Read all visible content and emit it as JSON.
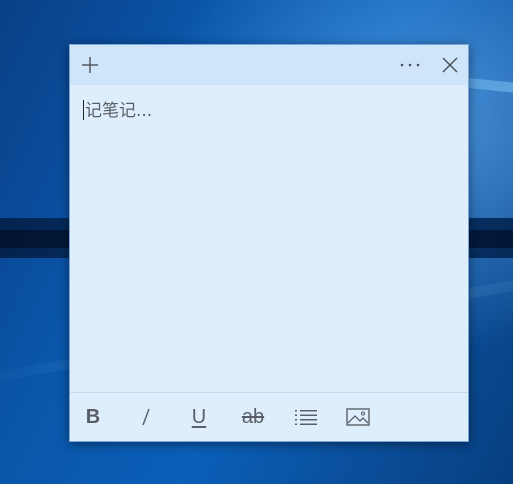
{
  "note": {
    "editor": {
      "placeholder": "记笔记..."
    },
    "titlebar": {
      "add_icon": "plus-icon",
      "menu_icon": "more-icon",
      "close_icon": "close-icon"
    },
    "toolbar": {
      "bold_label": "B",
      "italic_icon": "italic-icon",
      "underline_label": "U",
      "strikethrough_label": "ab",
      "list_icon": "bullet-list-icon",
      "image_icon": "image-icon"
    },
    "colors": {
      "note_background": "#dfeefd",
      "titlebar_background": "#cfe5fa",
      "icon_color": "#5b6068"
    }
  }
}
